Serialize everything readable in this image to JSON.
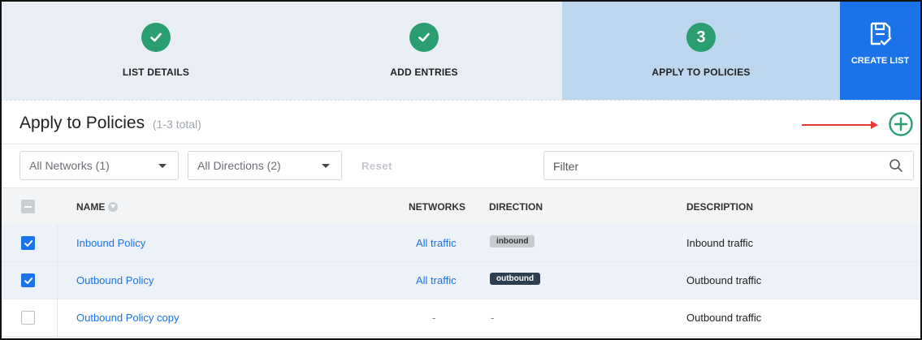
{
  "wizard": {
    "steps": [
      {
        "label": "LIST DETAILS",
        "state": "complete"
      },
      {
        "label": "ADD ENTRIES",
        "state": "complete"
      },
      {
        "label": "APPLY TO POLICIES",
        "number": "3",
        "state": "active"
      }
    ],
    "create_list_label": "CREATE LIST"
  },
  "page": {
    "title": "Apply to Policies",
    "count": "(1-3 total)"
  },
  "filters": {
    "networks": "All Networks (1)",
    "directions": "All Directions (2)",
    "reset": "Reset",
    "search_placeholder": "Filter"
  },
  "table": {
    "headers": {
      "name": "NAME",
      "networks": "NETWORKS",
      "direction": "DIRECTION",
      "description": "DESCRIPTION"
    },
    "rows": [
      {
        "name": "Inbound Policy",
        "networks": "All traffic",
        "direction": "inbound",
        "description": "Inbound traffic",
        "checked": true
      },
      {
        "name": "Outbound Policy",
        "networks": "All traffic",
        "direction": "outbound",
        "description": "Outbound traffic",
        "checked": true
      },
      {
        "name": "Outbound Policy copy",
        "networks": "-",
        "direction": "-",
        "description": "Outbound traffic",
        "checked": false
      }
    ]
  },
  "colors": {
    "step_complete": "#2a9d71",
    "active_step_bg": "#bcd6ee",
    "primary": "#1a73e8",
    "annotation_arrow": "#e53935"
  },
  "icons": {
    "step_done": "checkmark-icon",
    "create_list": "save-list-icon",
    "add": "plus-circle-icon",
    "search": "search-icon",
    "dropdown": "chevron-down-icon"
  }
}
